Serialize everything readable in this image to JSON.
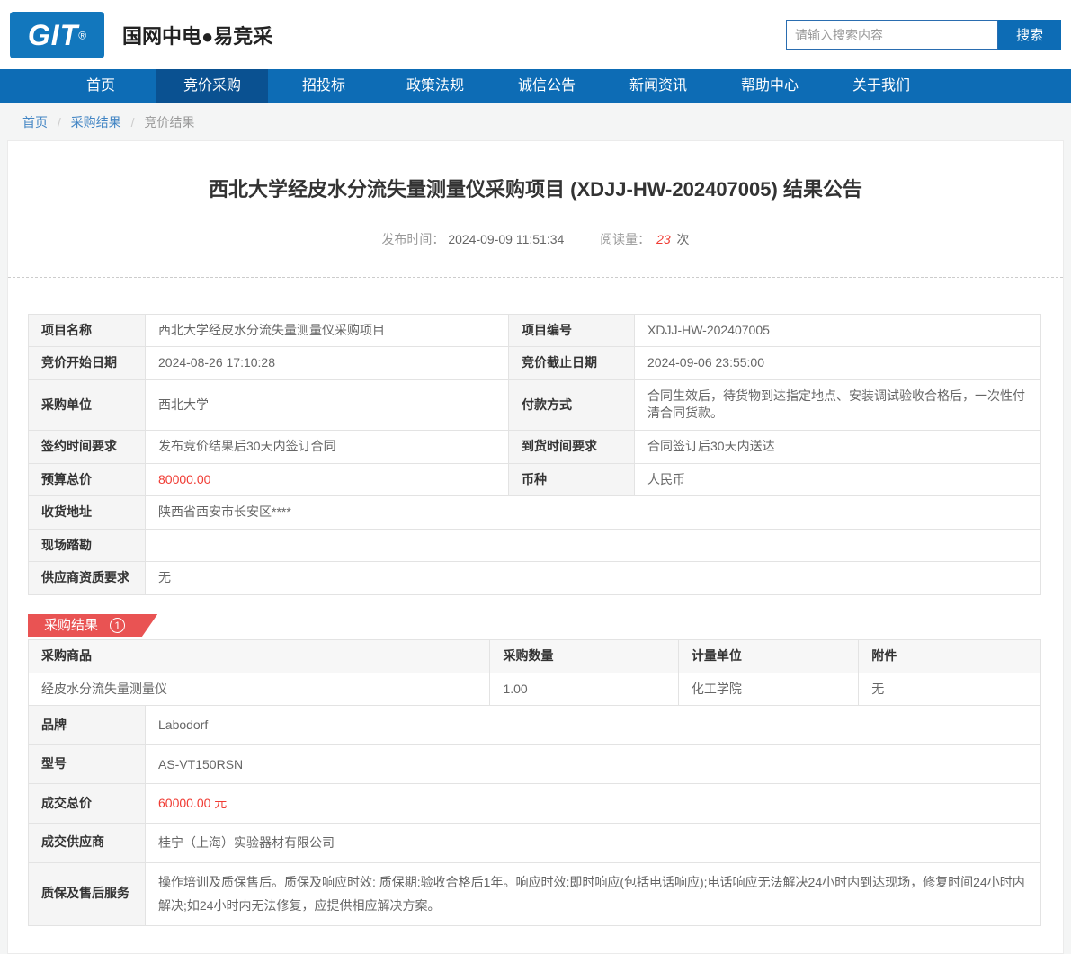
{
  "header": {
    "logo": {
      "text": "GIT",
      "reg": "®"
    },
    "site_title": "国网中电●易竞采",
    "search": {
      "placeholder": "请输入搜索内容",
      "button_label": "搜索"
    }
  },
  "nav": {
    "items": [
      {
        "label": "首页",
        "active": false
      },
      {
        "label": "竞价采购",
        "active": true
      },
      {
        "label": "招投标",
        "active": false
      },
      {
        "label": "政策法规",
        "active": false
      },
      {
        "label": "诚信公告",
        "active": false
      },
      {
        "label": "新闻资讯",
        "active": false
      },
      {
        "label": "帮助中心",
        "active": false
      },
      {
        "label": "关于我们",
        "active": false
      }
    ]
  },
  "breadcrumb": {
    "separator": "/",
    "items": [
      {
        "label": "首页"
      },
      {
        "label": "采购结果"
      },
      {
        "label": "竞价结果"
      }
    ]
  },
  "article": {
    "title": "西北大学经皮水分流失量测量仪采购项目 (XDJJ-HW-202407005) 结果公告",
    "meta": {
      "publish_label": "发布时间：",
      "publish_time": "2024-09-09 11:51:34",
      "views_label": "阅读量：",
      "views_count": "23",
      "views_unit": "次"
    }
  },
  "info_table": {
    "rows": [
      {
        "cells": [
          {
            "label": "项目名称",
            "value": "西北大学经皮水分流失量测量仪采购项目"
          },
          {
            "label": "项目编号",
            "value": "XDJJ-HW-202407005"
          }
        ]
      },
      {
        "cells": [
          {
            "label": "竞价开始日期",
            "value": "2024-08-26 17:10:28"
          },
          {
            "label": "竞价截止日期",
            "value": "2024-09-06 23:55:00"
          }
        ]
      },
      {
        "cells": [
          {
            "label": "采购单位",
            "value": "西北大学"
          },
          {
            "label": "付款方式",
            "value": "合同生效后，待货物到达指定地点、安装调试验收合格后，一次性付清合同货款。"
          }
        ]
      },
      {
        "cells": [
          {
            "label": "签约时间要求",
            "value": "发布竞价结果后30天内签订合同"
          },
          {
            "label": "到货时间要求",
            "value": "合同签订后30天内送达"
          }
        ]
      },
      {
        "cells": [
          {
            "label": "预算总价",
            "value": "80000.00"
          },
          {
            "label": "币种",
            "value": "人民币"
          }
        ]
      },
      {
        "cells": [
          {
            "label": "收货地址",
            "value": "陕西省西安市长安区****"
          }
        ]
      },
      {
        "cells": [
          {
            "label": "现场踏勘",
            "value": ""
          }
        ]
      },
      {
        "cells": [
          {
            "label": "供应商资质要求",
            "value": "无"
          }
        ]
      }
    ]
  },
  "result_section": {
    "badge": {
      "label": "采购结果",
      "count": "1"
    },
    "goods_table": {
      "headers": [
        "采购商品",
        "采购数量",
        "计量单位",
        "附件"
      ],
      "rows": [
        [
          "经皮水分流失量测量仪",
          "1.00",
          "化工学院",
          "无"
        ]
      ]
    },
    "detail_rows": [
      {
        "label": "品牌",
        "value": "Labodorf"
      },
      {
        "label": "型号",
        "value": "AS-VT150RSN"
      },
      {
        "label": "成交总价",
        "value": "60000.00 元"
      },
      {
        "label": "成交供应商",
        "value": "桂宁（上海）实验器材有限公司"
      },
      {
        "label": "质保及售后服务",
        "value": "操作培训及质保售后。质保及响应时效: 质保期:验收合格后1年。响应时效:即时响应(包括电话响应);电话响应无法解决24小时内到达现场，修复时间24小时内解决;如24小时内无法修复，应提供相应解决方案。"
      }
    ]
  },
  "colors": {
    "primary_blue": "#0d6cb5",
    "active_tab_blue": "#0a5191",
    "logo_blue": "#1277bd",
    "badge_red": "#e95353",
    "price_red": "#f03b33"
  }
}
